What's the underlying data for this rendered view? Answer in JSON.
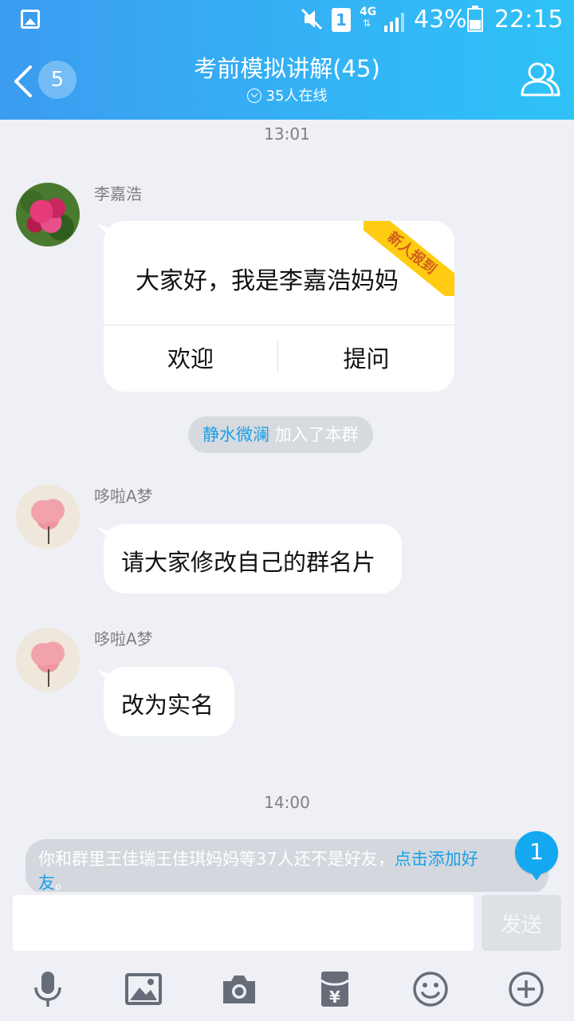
{
  "status_bar": {
    "sim_slot": "1",
    "network": "4G",
    "network_arrows": "⇅",
    "battery_percent": "43%",
    "battery_level": 0.43,
    "time": "22:15"
  },
  "header": {
    "unread_count": "5",
    "title": "考前模拟讲解(45)",
    "online_status": "35人在线"
  },
  "messages": {
    "timestamp_1": "13:01",
    "msg1": {
      "sender": "李嘉浩",
      "text": "大家好，我是李嘉浩妈妈",
      "ribbon": "新人报到",
      "action_welcome": "欢迎",
      "action_ask": "提问"
    },
    "join_notice": {
      "name": "静水微澜",
      "text": "加入了本群"
    },
    "msg2": {
      "sender": "哆啦A梦",
      "text": "请大家修改自己的群名片"
    },
    "msg3": {
      "sender": "哆啦A梦",
      "text": "改为实名"
    },
    "timestamp_2": "14:00"
  },
  "notice": {
    "text": "你和群里王佳瑞王佳琪妈妈等37人还不是好友，",
    "link_part1": "点击添加好",
    "link_part2": "友",
    "suffix": "。",
    "badge": "1"
  },
  "input": {
    "value": "",
    "placeholder": "",
    "send_label": "发送"
  },
  "toolbar": {
    "icons": [
      "microphone-icon",
      "image-icon",
      "camera-icon",
      "red-packet-icon",
      "emoji-icon",
      "plus-icon"
    ]
  },
  "colors": {
    "header_gradient_start": "#3b9cf0",
    "header_gradient_end": "#2ec2f6",
    "link": "#1aa0e8",
    "ribbon": "#ffcc11",
    "badge": "#13a8f0",
    "background": "#eef0f5"
  }
}
